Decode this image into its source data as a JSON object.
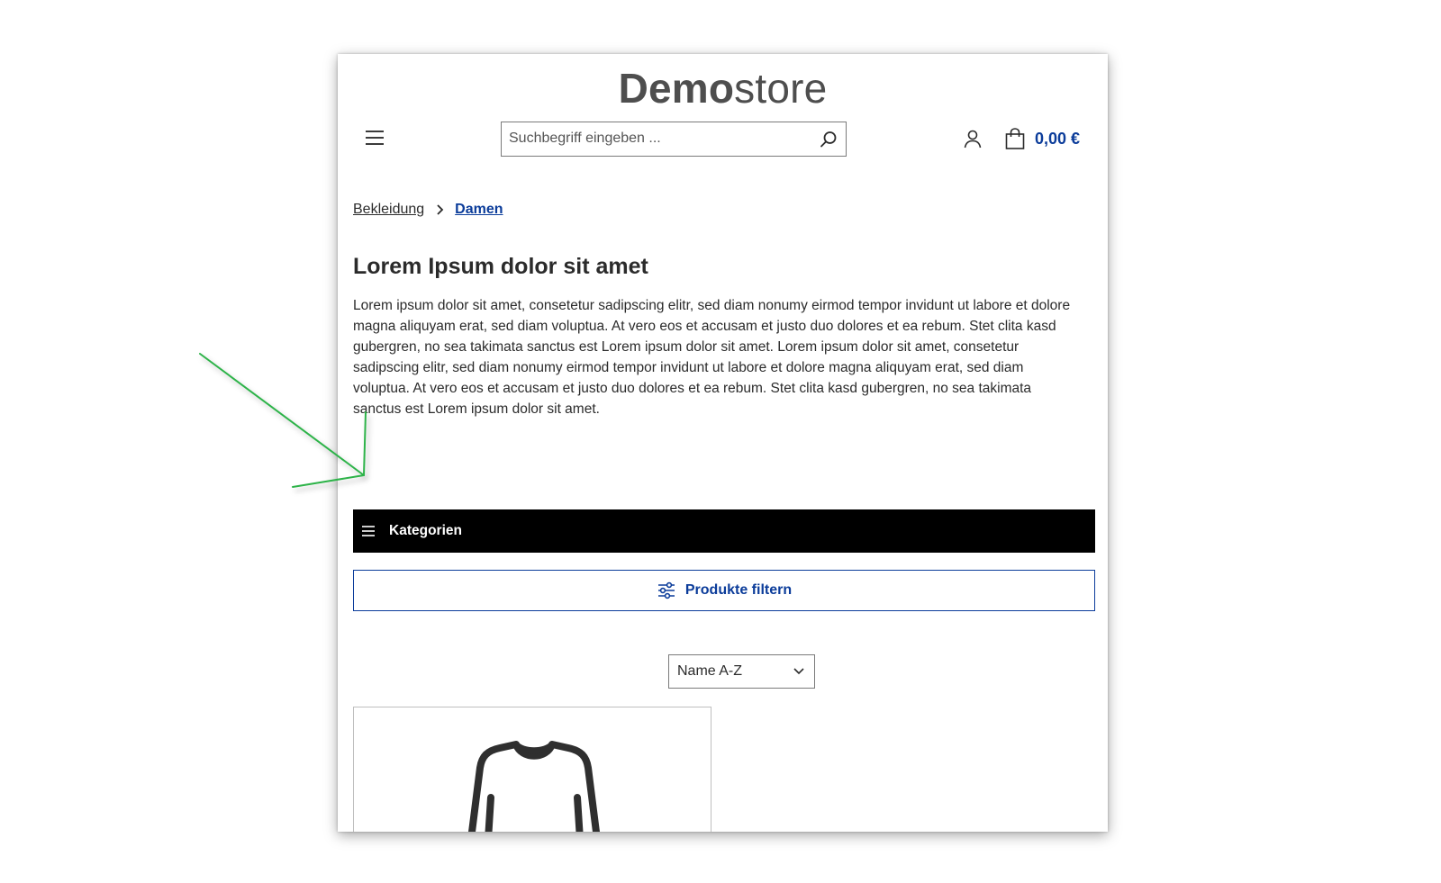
{
  "header": {
    "logo_bold": "Demo",
    "logo_light": "store",
    "search_placeholder": "Suchbegriff eingeben ...",
    "cart_total": "0,00 €"
  },
  "breadcrumb": {
    "items": [
      "Bekleidung"
    ],
    "current": "Damen"
  },
  "content": {
    "title": "Lorem Ipsum dolor sit amet",
    "description": "Lorem ipsum dolor sit amet, consetetur sadipscing elitr, sed diam nonumy eirmod tempor invidunt ut labore et dolore magna aliquyam erat, sed diam voluptua. At vero eos et accusam et justo duo dolores et ea rebum. Stet clita kasd gubergren, no sea takimata sanctus est Lorem ipsum dolor sit amet. Lorem ipsum dolor sit amet, consetetur sadipscing elitr, sed diam nonumy eirmod tempor invidunt ut labore et dolore magna aliquyam erat, sed diam voluptua. At vero eos et accusam et justo duo dolores et ea rebum. Stet clita kasd gubergren, no sea takimata sanctus est Lorem ipsum dolor sit amet."
  },
  "categories": {
    "label": "Kategorien"
  },
  "filter": {
    "label": "Produkte filtern"
  },
  "sort": {
    "selected": "Name A-Z"
  },
  "colors": {
    "accent": "#0b3c9a",
    "category_bar": "#000000",
    "annotation_arrow": "#2db34a"
  },
  "icons": [
    "menu-icon",
    "search-icon",
    "user-icon",
    "shopping-bag-icon",
    "chevron-right-icon",
    "filter-sliders-icon",
    "chevron-down-icon",
    "sweater-icon"
  ]
}
